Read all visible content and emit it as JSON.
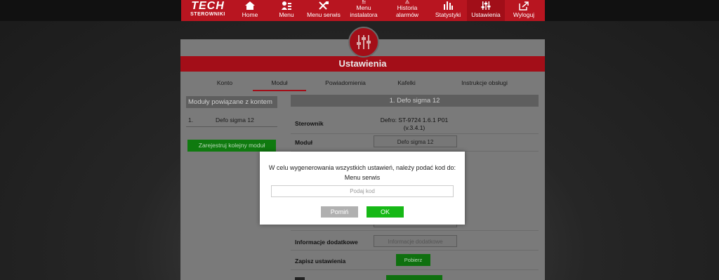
{
  "logo": {
    "line1": "TECH",
    "line2": "STEROWNIKI"
  },
  "nav": [
    {
      "label": "Home",
      "icon": "home-icon"
    },
    {
      "label": "Menu",
      "icon": "menu-icon"
    },
    {
      "label": "Menu serwis",
      "icon": "tools-icon"
    },
    {
      "label": "Menu instalatora",
      "icon": "installer-icon"
    },
    {
      "label": "Historia alarmów",
      "icon": "alarm-icon"
    },
    {
      "label": "Statystyki",
      "icon": "stats-icon"
    },
    {
      "label": "Ustawienia",
      "icon": "settings-icon",
      "active": true
    },
    {
      "label": "Wyloguj",
      "icon": "logout-icon"
    }
  ],
  "page": {
    "title": "Ustawienia"
  },
  "tabs": [
    "Konto",
    "Moduł",
    "Powiadomienia",
    "Kafelki",
    "Instrukcje obsługi"
  ],
  "sidebar": {
    "heading": "Moduły powiązane z kontem",
    "rows": [
      {
        "num": "1.",
        "name": "Defo sigma 12"
      }
    ],
    "register_button": "Zarejestruj kolejny moduł"
  },
  "main": {
    "heading": "1. Defo sigma 12",
    "rows": {
      "sterownik_label": "Sterownik",
      "sterownik_value_line1": "Defro: ST-9724 1.6.1 P01",
      "sterownik_value_line2": "(v.3.4.1)",
      "modul_label": "Moduł",
      "modul_value": "Defo sigma 12",
      "info_label": "Informacje dodatkowe",
      "info_placeholder": "Informacje dodatkowe",
      "save_label": "Zapisz ustawienia",
      "save_button": "Pobierz"
    }
  },
  "modal": {
    "message_line1": "W celu wygenerowania wszystkich ustawień, należy podać kod do:",
    "message_line2": "Menu serwis",
    "input_placeholder": "Podaj kod",
    "cancel_label": "Pomiń",
    "ok_label": "OK"
  },
  "colors": {
    "brand_red": "#b81520",
    "ok_green": "#16b816",
    "cancel_gray": "#b0b0b0"
  }
}
